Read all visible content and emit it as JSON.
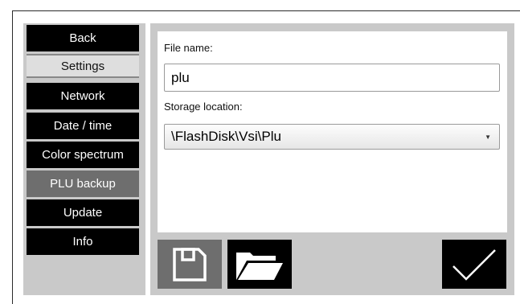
{
  "nav": {
    "back": "Back",
    "header": "Settings",
    "items": [
      {
        "label": "Network"
      },
      {
        "label": "Date / time"
      },
      {
        "label": "Color spectrum"
      },
      {
        "label": "PLU backup"
      },
      {
        "label": "Update"
      },
      {
        "label": "Info"
      }
    ],
    "active_item": "PLU backup"
  },
  "form": {
    "file_name_label": "File name:",
    "file_name_value": "plu",
    "storage_label": "Storage location:",
    "storage_value": "\\FlashDisk\\Vsi\\Plu"
  },
  "toolbar": {
    "save_icon": "floppy-disk-icon",
    "open_icon": "folder-open-icon",
    "confirm_icon": "checkmark-icon"
  },
  "colors": {
    "panel_bg": "#c9c9c9",
    "button_bg": "#000000",
    "active_bg": "#6e6e6e"
  }
}
